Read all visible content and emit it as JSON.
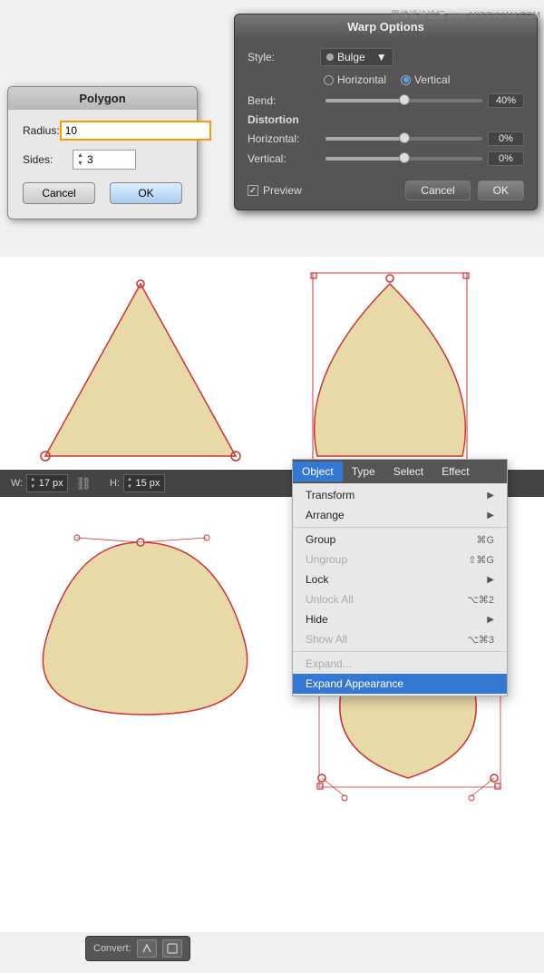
{
  "watermark": {
    "text": "思缘设计论坛 www.MISSVUAN.COM"
  },
  "polygon_dialog": {
    "title": "Polygon",
    "radius_label": "Radius:",
    "radius_value": "10",
    "sides_label": "Sides:",
    "sides_value": "3",
    "cancel_label": "Cancel",
    "ok_label": "OK"
  },
  "warp_dialog": {
    "title": "Warp Options",
    "style_label": "Style:",
    "style_value": "Bulge",
    "horizontal_label": "Horizontal",
    "vertical_label": "Vertical",
    "bend_label": "Bend:",
    "bend_value": "40%",
    "bend_percent": 40,
    "distortion_label": "Distortion",
    "horiz_label": "Horizontal:",
    "horiz_value": "0%",
    "vert_label": "Vertical:",
    "vert_value": "0%",
    "preview_label": "Preview",
    "cancel_label": "Cancel",
    "ok_label": "OK"
  },
  "toolbar": {
    "w_label": "W:",
    "w_value": "17 px",
    "h_label": "H:",
    "h_value": "15 px"
  },
  "menu": {
    "items": [
      "Object",
      "Type",
      "Select",
      "Effect"
    ],
    "active_item": "Object",
    "entries": [
      {
        "label": "Transform",
        "shortcut": "",
        "arrow": true,
        "disabled": false
      },
      {
        "label": "Arrange",
        "shortcut": "",
        "arrow": true,
        "disabled": false
      },
      {
        "separator_after": true
      },
      {
        "label": "Group",
        "shortcut": "⌘G",
        "arrow": false,
        "disabled": false
      },
      {
        "label": "Ungroup",
        "shortcut": "⇧⌘G",
        "arrow": false,
        "disabled": true
      },
      {
        "label": "Lock",
        "shortcut": "",
        "arrow": true,
        "disabled": false
      },
      {
        "label": "Unlock All",
        "shortcut": "⌥⌘2",
        "arrow": false,
        "disabled": true
      },
      {
        "label": "Hide",
        "shortcut": "",
        "arrow": true,
        "disabled": false
      },
      {
        "label": "Show All",
        "shortcut": "⌥⌘3",
        "arrow": false,
        "disabled": true
      },
      {
        "separator_after": true
      },
      {
        "label": "Expand...",
        "shortcut": "",
        "arrow": false,
        "disabled": true
      },
      {
        "label": "Expand Appearance",
        "shortcut": "",
        "arrow": false,
        "disabled": false,
        "selected": true
      }
    ]
  },
  "convert_toolbar": {
    "label": "Convert:",
    "btn1_icon": "↗",
    "btn2_icon": "⬜"
  }
}
